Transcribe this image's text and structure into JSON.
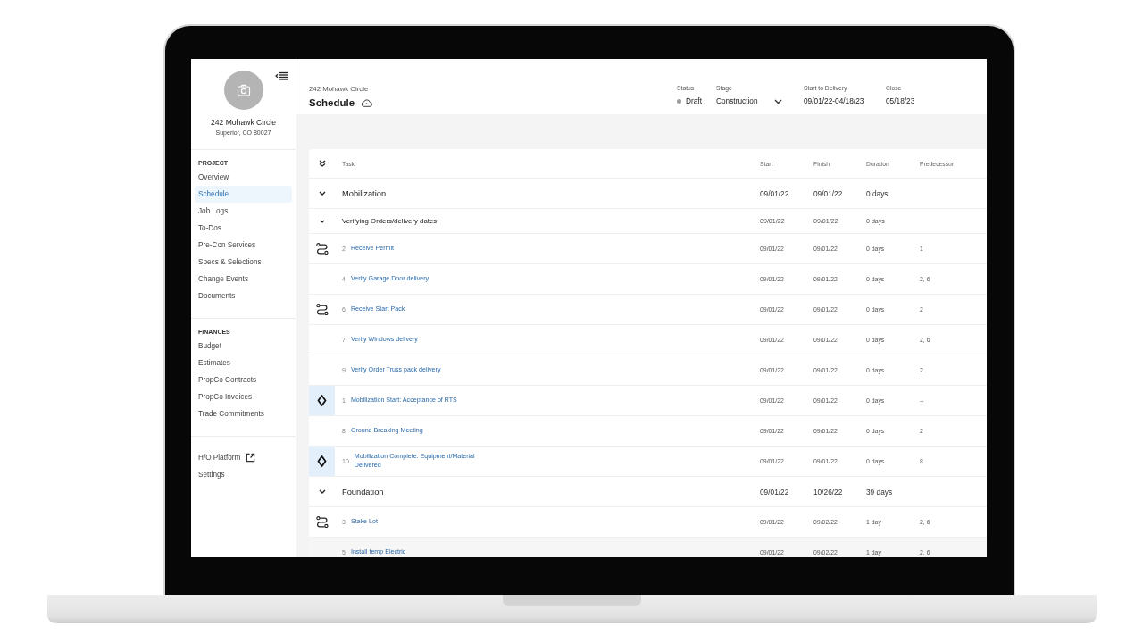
{
  "sidebar": {
    "project_name": "242 Mohawk Circle",
    "address": "Superior, CO 80027",
    "sections": [
      {
        "heading": "PROJECT",
        "items": [
          {
            "label": "Overview",
            "selected": false
          },
          {
            "label": "Schedule",
            "selected": true
          },
          {
            "label": "Job Logs",
            "selected": false
          },
          {
            "label": "To-Dos",
            "selected": false
          },
          {
            "label": "Pre-Con Services",
            "selected": false
          },
          {
            "label": "Specs & Selections",
            "selected": false
          },
          {
            "label": "Change Events",
            "selected": false
          },
          {
            "label": "Documents",
            "selected": false
          }
        ]
      },
      {
        "heading": "FINANCES",
        "items": [
          {
            "label": "Budget",
            "selected": false
          },
          {
            "label": "Estimates",
            "selected": false
          },
          {
            "label": "PropCo Contracts",
            "selected": false
          },
          {
            "label": "PropCo Invoices",
            "selected": false
          },
          {
            "label": "Trade Commitments",
            "selected": false
          }
        ]
      },
      {
        "items": [
          {
            "label": "H/O Platform",
            "selected": false,
            "external": true
          },
          {
            "label": "Settings",
            "selected": false,
            "external": false
          }
        ]
      }
    ]
  },
  "header": {
    "breadcrumb": "242 Mohawk Circle",
    "title": "Schedule",
    "fields": [
      {
        "kind": "status",
        "label": "Status",
        "value": "Draft"
      },
      {
        "kind": "dropdown",
        "label": "Stage",
        "value": "Construction"
      },
      {
        "kind": "text",
        "label": "Start to Delivery",
        "value": "09/01/22-04/18/23"
      },
      {
        "kind": "text",
        "label": "Close",
        "value": "05/18/23"
      }
    ]
  },
  "table": {
    "columns": [
      "Task",
      "Start",
      "Finish",
      "Duration",
      "Predecessor"
    ],
    "rows": [
      {
        "kind": "group",
        "name": "Mobilization",
        "start": "09/01/22",
        "finish": "09/01/22",
        "duration": "0 days",
        "expanded": true,
        "children": [
          {
            "kind": "subgroup",
            "name": "Verifying Orders/delivery dates",
            "start": "09/01/22",
            "finish": "09/01/22",
            "duration": "0 days",
            "expanded": true,
            "children": [
              {
                "kind": "task",
                "number": "2",
                "name": "Receive Permit",
                "start": "09/01/22",
                "finish": "09/01/22",
                "duration": "0 days",
                "predecessor": "1",
                "route": true,
                "highlighted": false
              },
              {
                "kind": "task",
                "number": "4",
                "name": "Verify Garage Door delivery",
                "start": "09/01/22",
                "finish": "09/01/22",
                "duration": "0 days",
                "predecessor": "2, 6",
                "route": false,
                "highlighted": false
              },
              {
                "kind": "task",
                "number": "6",
                "name": "Receive Start Pack",
                "start": "09/01/22",
                "finish": "09/01/22",
                "duration": "0 days",
                "predecessor": "2",
                "route": true,
                "highlighted": false
              },
              {
                "kind": "task",
                "number": "7",
                "name": "Verify Windows delivery",
                "start": "09/01/22",
                "finish": "09/01/22",
                "duration": "0 days",
                "predecessor": "2, 6",
                "route": false,
                "highlighted": false
              },
              {
                "kind": "task",
                "number": "9",
                "name": "Verify Order Truss pack delivery",
                "start": "09/01/22",
                "finish": "09/01/22",
                "duration": "0 days",
                "predecessor": "2",
                "route": false,
                "highlighted": false
              }
            ]
          },
          {
            "kind": "milestone",
            "number": "1",
            "name": "Mobilization Start: Acceptance of RTS",
            "start": "09/01/22",
            "finish": "09/01/22",
            "duration": "0 days",
            "predecessor": "--",
            "highlighted": false
          },
          {
            "kind": "task",
            "number": "8",
            "name": "Ground Breaking Meeting",
            "start": "09/01/22",
            "finish": "09/01/22",
            "duration": "0 days",
            "predecessor": "2",
            "route": false,
            "highlighted": false
          },
          {
            "kind": "milestone",
            "number": "10",
            "name": "Mobilization Complete: Equipment/Material Delivered",
            "start": "09/01/22",
            "finish": "09/01/22",
            "duration": "0 days",
            "predecessor": "8",
            "highlighted": false
          }
        ]
      },
      {
        "kind": "group",
        "name": "Foundation",
        "start": "09/01/22",
        "finish": "10/26/22",
        "duration": "39 days",
        "expanded": true,
        "children": [
          {
            "kind": "task",
            "number": "3",
            "name": "Stake Lot",
            "start": "09/01/22",
            "finish": "09/02/22",
            "duration": "1 day",
            "predecessor": "2, 6",
            "route": true,
            "highlighted": false
          },
          {
            "kind": "task",
            "number": "5",
            "name": "Install temp Electric",
            "start": "09/01/22",
            "finish": "09/02/22",
            "duration": "1 day",
            "predecessor": "2, 6",
            "route": false,
            "highlighted": true
          }
        ]
      }
    ]
  }
}
